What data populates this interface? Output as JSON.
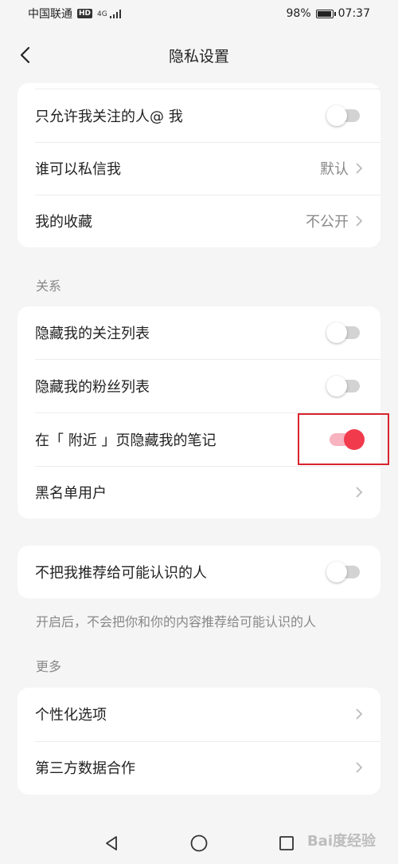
{
  "status_bar": {
    "carrier": "中国联通",
    "hd": "HD",
    "signal": "4G",
    "battery": "98%",
    "time": "07:37"
  },
  "header": {
    "title": "隐私设置"
  },
  "card1": {
    "rows": [
      {
        "label": "只允许我关注的人@ 我",
        "toggle": false
      },
      {
        "label": "谁可以私信我",
        "value": "默认"
      },
      {
        "label": "我的收藏",
        "value": "不公开"
      }
    ]
  },
  "section_relation": "关系",
  "card2": {
    "rows": [
      {
        "label": "隐藏我的关注列表",
        "toggle": false
      },
      {
        "label": "隐藏我的粉丝列表",
        "toggle": false
      },
      {
        "label": "在「 附近 」页隐藏我的笔记",
        "toggle": true
      },
      {
        "label": "黑名单用户"
      }
    ]
  },
  "card3": {
    "rows": [
      {
        "label": "不把我推荐给可能认识的人",
        "toggle": false
      }
    ]
  },
  "card3_hint": "开启后，不会把你和你的内容推荐给可能认识的人",
  "section_more": "更多",
  "card4": {
    "rows": [
      {
        "label": "个性化选项"
      },
      {
        "label": "第三方数据合作"
      }
    ]
  },
  "watermark": "Bai度经验",
  "colors": {
    "accent": "#f23a4d",
    "highlight": "#d8242f"
  }
}
